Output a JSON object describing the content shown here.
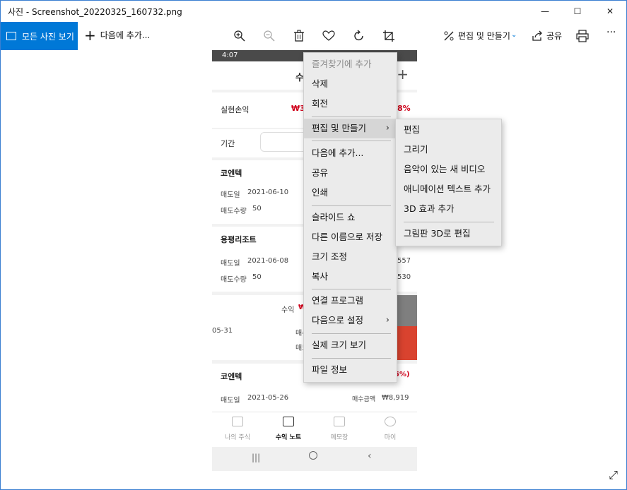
{
  "window": {
    "title": "사진 - Screenshot_20220325_160732.png",
    "minimize": "—",
    "maximize": "☐",
    "close": "✕"
  },
  "toolbar": {
    "all_photos": "모든 사진 보기",
    "add_to": "다음에 추가...",
    "edit_create": "편집 및 만들기",
    "share": "공유",
    "more": "···",
    "accent": "#0078d7"
  },
  "phone": {
    "status_time": "4:07",
    "header_fragment": "수",
    "realized_label": "실현손익",
    "realized_value": "₩3",
    "realized_pct": "8%",
    "period_label": "기간",
    "stock1": "코엔텍",
    "sell_date_label": "매도일",
    "sell_qty_label": "매도수량",
    "stock1_date": "2021-06-10",
    "stock1_qty": "50",
    "stock2": "용평리조트",
    "stock2_date": "2021-06-08",
    "stock2_qty": "50",
    "stock2_v1": "557",
    "stock2_v2": "530",
    "profit_label": "수익",
    "profit_value": "₩",
    "date_frag": "05-31",
    "buy_frag1": "매수",
    "buy_frag2": "매도",
    "stock3": "코엔텍",
    "stock3_pct": "5%)",
    "stock3_date": "2021-05-26",
    "buy_amount_label": "매수금액",
    "buy_amount": "₩8,919",
    "nav": [
      "나의 주식",
      "수익 노트",
      "메모장",
      "마이"
    ]
  },
  "context_menu": {
    "items": [
      {
        "label": "즐겨찾기에 추가",
        "disabled": true
      },
      {
        "label": "삭제"
      },
      {
        "label": "회전"
      },
      {
        "label": "편집 및 만들기",
        "submenu": true
      },
      {
        "label": "다음에 추가..."
      },
      {
        "label": "공유"
      },
      {
        "label": "인쇄"
      },
      {
        "label": "슬라이드 쇼"
      },
      {
        "label": "다른 이름으로 저장"
      },
      {
        "label": "크기 조정"
      },
      {
        "label": "복사"
      },
      {
        "label": "연결 프로그램"
      },
      {
        "label": "다음으로 설정",
        "submenu": true
      },
      {
        "label": "실제 크기 보기"
      },
      {
        "label": "파일 정보"
      }
    ]
  },
  "submenu": {
    "items": [
      "편집",
      "그리기",
      "음악이 있는 새 비디오",
      "애니메이션 텍스트 추가",
      "3D 효과 추가",
      "그림판 3D로 편집"
    ]
  }
}
